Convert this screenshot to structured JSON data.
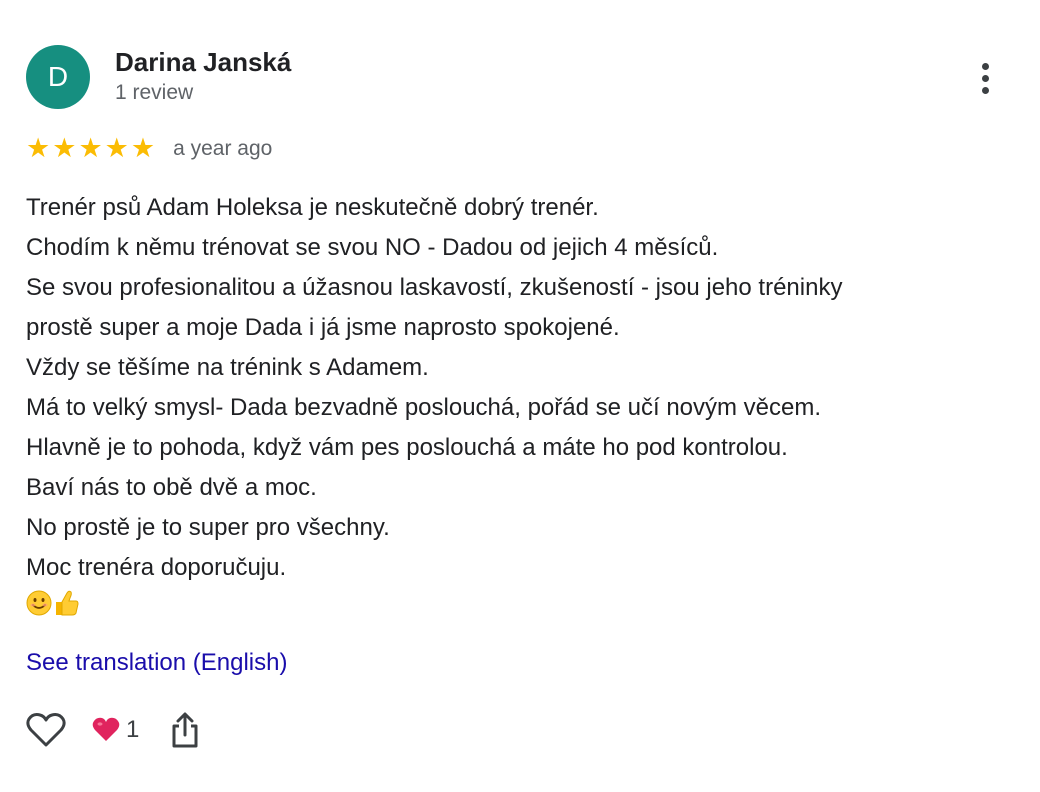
{
  "reviewer": {
    "avatar_letter": "D",
    "avatar_color": "#168f80",
    "name": "Darina Janská",
    "review_count": "1 review"
  },
  "menu": {
    "icon": "more-vertical-icon"
  },
  "rating": {
    "stars": 5,
    "max_stars": 5,
    "star_color": "#fbbc04",
    "time": "a year ago"
  },
  "review": {
    "lines": [
      "Trenér psů Adam Holeksa je neskutečně dobrý trenér.",
      "Chodím k němu trénovat se svou NO - Dadou od jejich 4 měsíců.",
      "Se svou profesionalitou a úžasnou laskavostí, zkušeností - jsou jeho tréninky",
      "prostě super a moje Dada i já jsme naprosto spokojené.",
      "Vždy se těšíme na trénink s Adamem.",
      "Má to velký smysl- Dada bezvadně poslouchá, pořád se učí novým věcem.",
      "Hlavně je to pohoda, když vám pes poslouchá a máte ho pod kontrolou.",
      "Baví nás to obě dvě a moc.",
      "No prostě je to super pro všechny.",
      "Moc trenéra doporučuju."
    ],
    "emoji_smile": "smiling-face-icon",
    "emoji_thumbs": "thumbs-up-icon"
  },
  "translation": {
    "link_text": "See translation (English)",
    "link_color": "#1a0dab"
  },
  "actions": {
    "like_icon": "heart-outline-icon",
    "reaction_icon": "red-heart-icon",
    "reaction_count": "1",
    "share_icon": "share-icon"
  }
}
